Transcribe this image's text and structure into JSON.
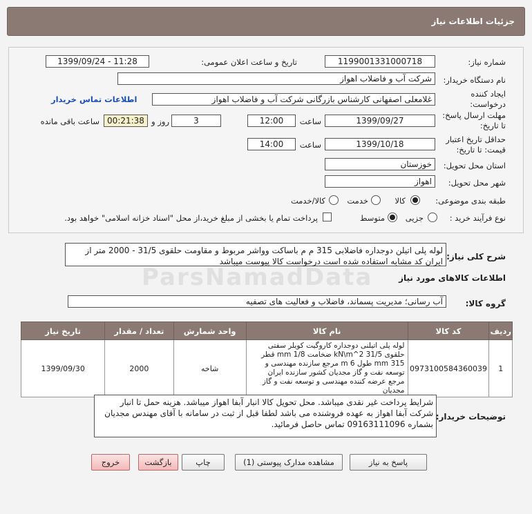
{
  "page_title": "جزئیات اطلاعات نیاز",
  "watermark": "ParsNamadData",
  "fields": {
    "need_number_label": "شماره نیاز:",
    "need_number": "1199001331000718",
    "announce_label": "تاریخ و ساعت اعلان عمومی:",
    "announce_value": "1399/09/24 - 11:28",
    "buyer_org_label": "نام دستگاه خریدار:",
    "buyer_org": "شرکت آب و فاضلاب اهواز",
    "creator_label": "ایجاد کننده درخواست:",
    "creator": "غلامعلی اصفهانی کارشناس بازرگانی شرکت آب و فاضلاب اهواز",
    "buyer_contact_link": "اطلاعات تماس خریدار",
    "send_deadline_label": "مهلت ارسال پاسخ: تا تاریخ:",
    "send_date": "1399/09/27",
    "time_label": "ساعت",
    "send_time": "12:00",
    "days_value": "3",
    "days_label": "روز و",
    "remaining_time": "00:21:38",
    "remaining_label": "ساعت باقی مانده",
    "price_validity_label": "حداقل تاریخ اعتبار قیمت: تا تاریخ:",
    "price_date": "1399/10/18",
    "price_time": "14:00",
    "province_label": "استان محل تحویل:",
    "province": "خوزستان",
    "city_label": "شهر محل تحویل:",
    "city": "اهواز",
    "category_label": "طبقه بندی موضوعی:",
    "category_options": [
      "کالا",
      "خدمت",
      "کالا/خدمت"
    ],
    "process_label": "نوع فرآیند خرید :",
    "process_options": [
      "جزیی",
      "متوسط"
    ],
    "payment_note": "پرداخت تمام یا بخشی از مبلغ خرید،از محل \"اسناد خزانه اسلامی\" خواهد بود."
  },
  "general_desc_label": "شرح کلی نیاز:",
  "general_desc": "لوله پلی اتیلن دوجداره فاضلابی 315 م م باساکت وواشر مربوط و مقاومت حلقوی 31/5 - 2000 متر از ایران کد مشابه استفاده شده است درخواست کالا پیوست میباشد",
  "goods_info_title": "اطلاعات کالاهای مورد نیاز",
  "goods_group_label": "گروه کالا:",
  "goods_group": "آب رسانی؛ مدیریت پسماند، فاضلاب و فعالیت های تصفیه",
  "table": {
    "headers": [
      "ردیف",
      "کد کالا",
      "نام کالا",
      "واحد شمارش",
      "تعداد / مقدار",
      "تاریخ نیاز"
    ],
    "rows": [
      {
        "row": "1",
        "code": "0973100584360039",
        "name": "لوله پلی اتیلنی دوجداره کاروگیت کویلر سفتی حلقوی 31/5 kN\\m^2 ضخامت mm 1/8 قطر mm 315 طول m 6 مرجع سازنده مهندسی و توسعه نفت و گاز مجدیان کشور سازنده ایران مرجع عرضه کننده مهندسی و توسعه نفت و گاز مجدیان",
        "unit": "شاخه",
        "qty": "2000",
        "date": "1399/09/30"
      }
    ]
  },
  "buyer_notes_label": "توضیحات خریدار:",
  "buyer_notes": "شرایط پرداخت غیر نقدی میباشد. محل تحویل کالا انبار آبفا اهواز میباشد. هزینه حمل تا  انبار شرکت آبفا اهواز به عهده فروشنده می باشد لطفا قبل از ثبت در سامانه با آقای مهندس مجدیان بشماره 09163111096 تماس حاصل فرمائید.",
  "buttons": {
    "reply": "پاسخ به نیاز",
    "view_docs": "مشاهده مدارک پیوستی (1)",
    "print": "چاپ",
    "back": "بازگشت",
    "exit": "خروج"
  }
}
